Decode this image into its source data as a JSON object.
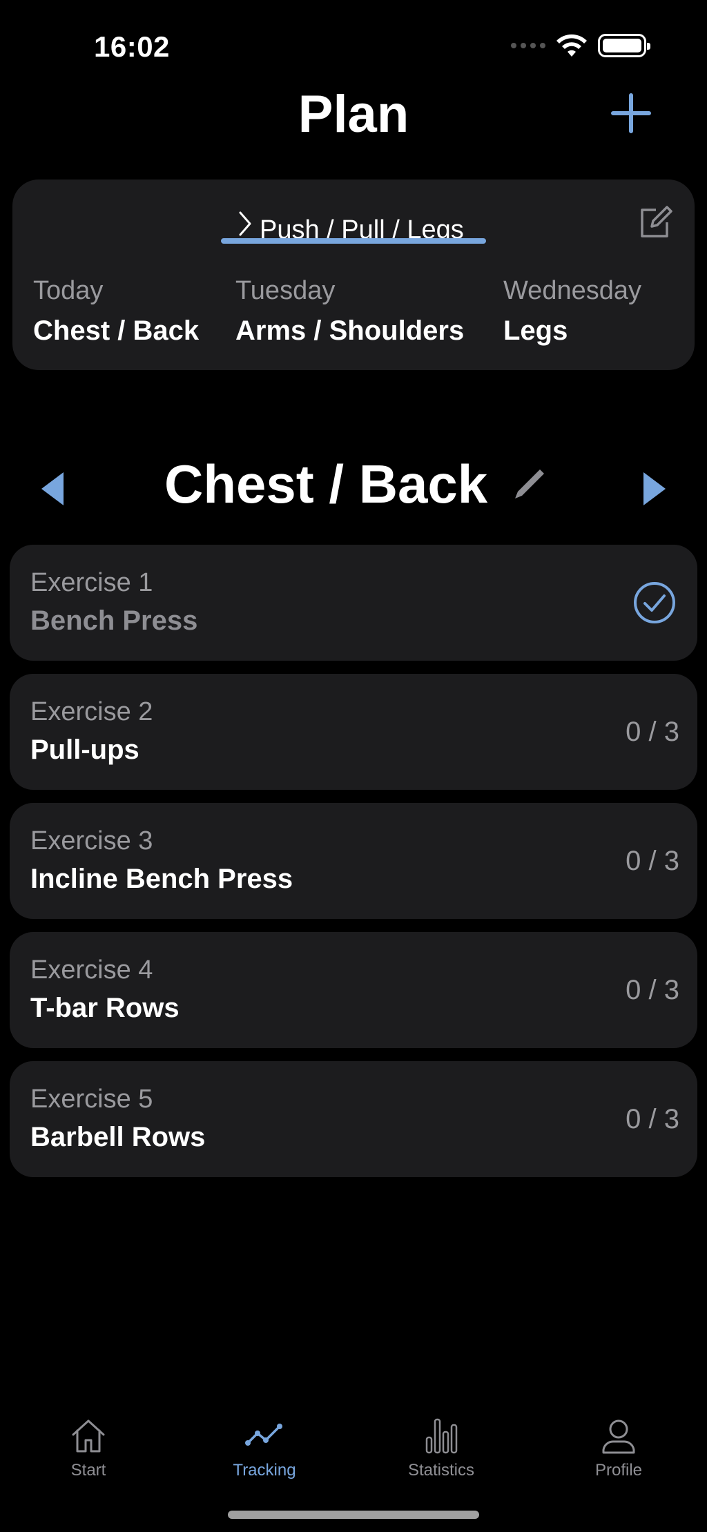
{
  "status_bar": {
    "time": "16:02"
  },
  "header": {
    "title": "Plan"
  },
  "plan_card": {
    "plan_name": "Push / Pull / Legs",
    "days": [
      {
        "label": "Today",
        "workout": "Chest / Back"
      },
      {
        "label": "Tuesday",
        "workout": "Arms / Shoulders"
      },
      {
        "label": "Wednesday",
        "workout": "Legs"
      }
    ]
  },
  "workout": {
    "title": "Chest / Back",
    "exercises": [
      {
        "label": "Exercise 1",
        "name": "Bench Press",
        "completed": true
      },
      {
        "label": "Exercise 2",
        "name": "Pull-ups",
        "progress": "0 / 3"
      },
      {
        "label": "Exercise 3",
        "name": "Incline Bench Press",
        "progress": "0 / 3"
      },
      {
        "label": "Exercise 4",
        "name": "T-bar Rows",
        "progress": "0 / 3"
      },
      {
        "label": "Exercise 5",
        "name": "Barbell Rows",
        "progress": "0 / 3"
      }
    ]
  },
  "tab_bar": {
    "tabs": [
      {
        "label": "Start",
        "icon": "home-icon"
      },
      {
        "label": "Tracking",
        "icon": "tracking-icon",
        "active": true
      },
      {
        "label": "Statistics",
        "icon": "bar-chart-icon"
      },
      {
        "label": "Profile",
        "icon": "person-icon"
      }
    ]
  },
  "colors": {
    "accent": "#78a6de",
    "card": "#1c1c1e",
    "background": "#000000",
    "muted": "#9a9a9e"
  }
}
